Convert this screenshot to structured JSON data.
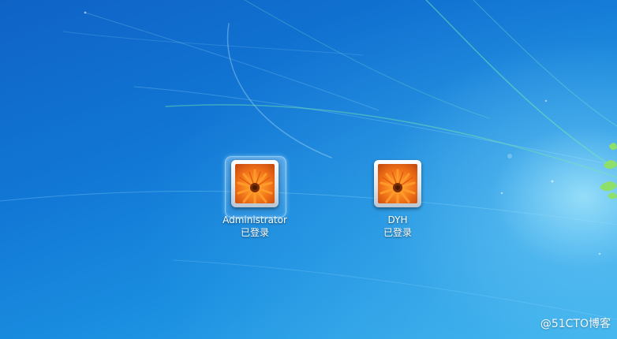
{
  "users": [
    {
      "name": "Administrator",
      "status": "已登录",
      "selected": true
    },
    {
      "name": "DYH",
      "status": "已登录",
      "selected": false
    }
  ],
  "watermark": "@51CTO博客",
  "colors": {
    "background_top": "#0f63c6",
    "background_bottom": "#3cb4ee",
    "flower_orange": "#f07018",
    "text": "#ffffff"
  }
}
